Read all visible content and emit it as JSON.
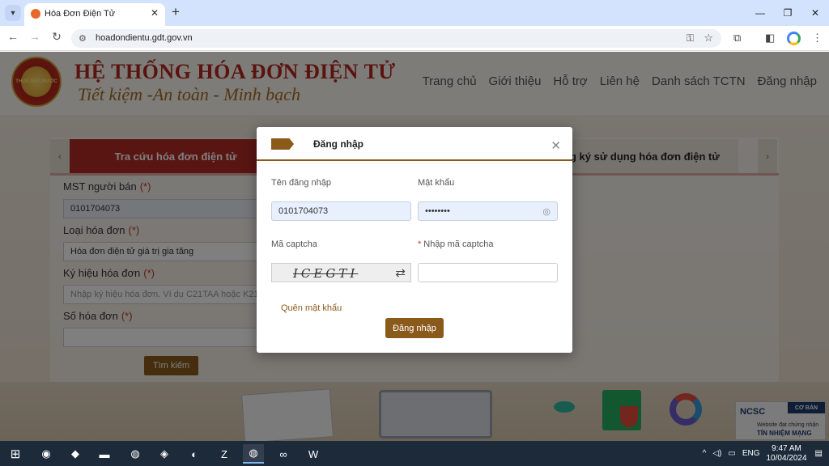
{
  "browser": {
    "tab_title": "Hóa Đơn Điện Tử",
    "url": "hoadondientu.gdt.gov.vn",
    "new_tab": "+",
    "close_tab": "✕",
    "minimize": "—",
    "restore": "❐",
    "close": "✕"
  },
  "site": {
    "emblem_text": "THUẾ NHÀ NƯỚC",
    "title": "HỆ THỐNG HÓA ĐƠN ĐIỆN TỬ",
    "slogan": "Tiết kiệm -An toàn - Minh bạch",
    "nav": [
      "Trang chủ",
      "Giới thiệu",
      "Hỗ trợ",
      "Liên hệ",
      "Danh sách TCTN",
      "Đăng nhập"
    ]
  },
  "tabs": {
    "active": "Tra cứu hóa đơn điện tử",
    "other": "g ký sử dụng hóa đơn điện tử",
    "prev": "‹",
    "next": "›"
  },
  "form": {
    "seller_tax_label": "MST người bán",
    "seller_tax_value": "0101704073",
    "invoice_type_label": "Loại hóa đơn",
    "invoice_type_value": "Hóa đơn điện tử giá trị gia tăng",
    "symbol_label": "Ký hiệu hóa đơn",
    "symbol_placeholder": "Nhập ký hiệu hóa đơn. Ví dụ C21TAA hoặc K21TAA",
    "number_label": "Số hóa đơn",
    "required_mark": "(*)",
    "search_button": "Tìm kiếm"
  },
  "badge": {
    "band": "CƠ BẢN",
    "logo": "NCSC",
    "line1": "Website đạt chứng nhận",
    "line2": "TÍN NHIỆM MẠNG"
  },
  "modal": {
    "title": "Đăng nhập",
    "close": "✕",
    "username_label": "Tên đăng nhập",
    "username_value": "0101704073",
    "password_label": "Mật khẩu",
    "password_value": "••••••••",
    "captcha_label": "Mã captcha",
    "captcha_text": "ICEGTI",
    "captcha_input_label": "Nhập mã captcha",
    "required_mark": "*",
    "forgot": "Quên mật khẩu",
    "submit": "Đăng nhập"
  },
  "taskbar": {
    "lang": "ENG",
    "time": "9:47 AM",
    "date": "10/04/2024"
  }
}
